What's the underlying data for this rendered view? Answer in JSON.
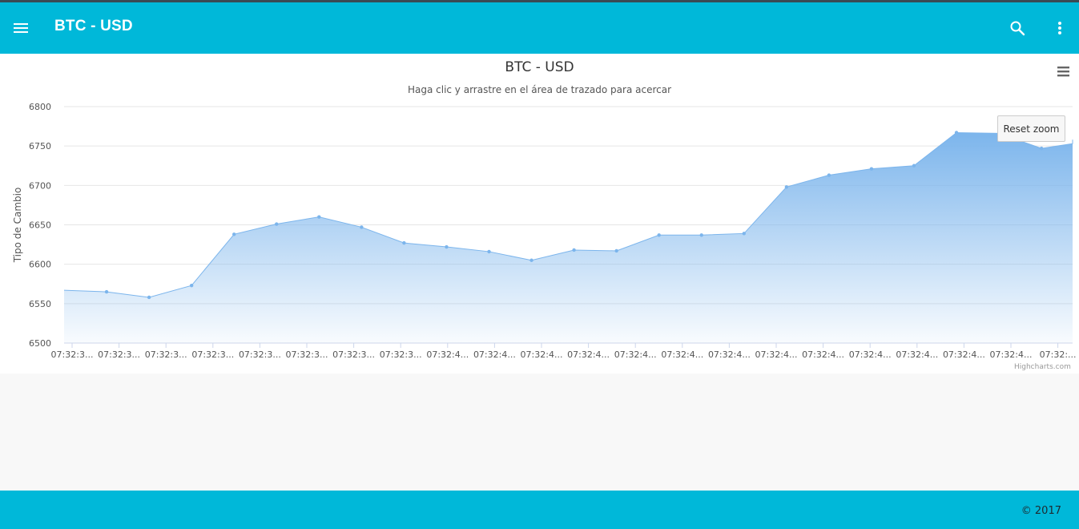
{
  "appbar": {
    "title": "BTC - USD",
    "menu_icon": "menu-icon",
    "search_icon": "search-icon",
    "more_icon": "more-vert-icon",
    "color": "#00b8d9"
  },
  "chart": {
    "reset_zoom_label": "Reset zoom",
    "credit": "Highcharts.com",
    "export_icon": "hamburger-menu-icon"
  },
  "chart_data": {
    "type": "area",
    "title": "BTC - USD",
    "subtitle": "Haga clic y arrastre en el área de trazado para acercar",
    "ylabel": "Tipo de Cambio",
    "xlabel": "",
    "ylim": [
      6500,
      6800
    ],
    "yticks": [
      6500,
      6550,
      6600,
      6650,
      6700,
      6750,
      6800
    ],
    "grid": true,
    "legend": "none",
    "color": "#7cb5ec",
    "x_tick_labels": [
      "07:32:3...",
      "07:32:3...",
      "07:32:3...",
      "07:32:3...",
      "07:32:3...",
      "07:32:3...",
      "07:32:3...",
      "07:32:3...",
      "07:32:4...",
      "07:32:4...",
      "07:32:4...",
      "07:32:4...",
      "07:32:4...",
      "07:32:4...",
      "07:32:4...",
      "07:32:4...",
      "07:32:4...",
      "07:32:4...",
      "07:32:4...",
      "07:32:4...",
      "07:32:4...",
      "07:32:..."
    ],
    "series": [
      {
        "values": [
          6567,
          6565,
          6558,
          6573,
          6638,
          6651,
          6660,
          6647,
          6627,
          6622,
          6616,
          6605,
          6618,
          6617,
          6637,
          6637,
          6639,
          6698,
          6713,
          6721,
          6725,
          6767,
          6766,
          6747,
          6753,
          6758
        ]
      }
    ]
  },
  "footer": {
    "copyright": "© 2017",
    "color": "#00b8d9"
  }
}
